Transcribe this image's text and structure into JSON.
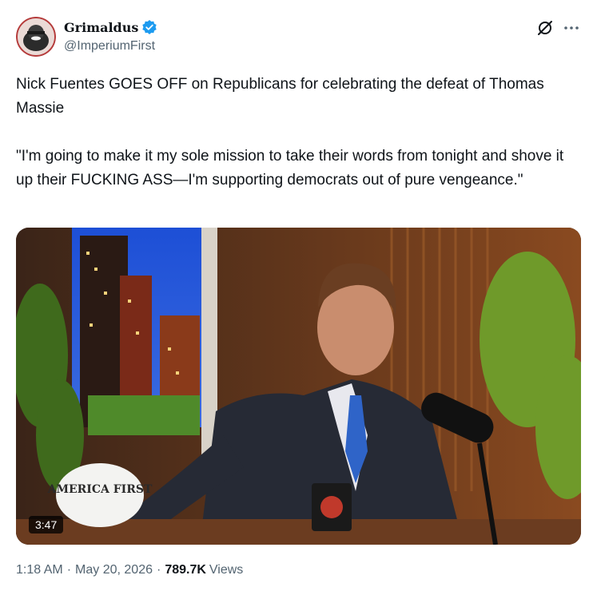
{
  "author": {
    "display_name": "Grimaldus",
    "handle": "@ImperiumFirst",
    "verified_icon": "verified-badge-icon"
  },
  "header_icons": [
    "grok-icon",
    "more-icon"
  ],
  "tweet": {
    "text": "Nick Fuentes GOES OFF on Republicans for celebrating the defeat of Thomas Massie\n\n\"I'm going to make it my sole mission to take their words from tonight and shove it up their FUCKING ASS—I'm supporting democrats out of pure vengeance.\""
  },
  "media": {
    "duration": "3:47",
    "hat_text": "AMERICA FIRST"
  },
  "meta": {
    "time": "1:18 AM",
    "date": "May 20, 2026",
    "separator": "·",
    "views_count": "789.7K",
    "views_label": "Views"
  },
  "colors": {
    "text": "#0f1419",
    "secondary": "#536471",
    "verified": "#1d9bf0"
  }
}
